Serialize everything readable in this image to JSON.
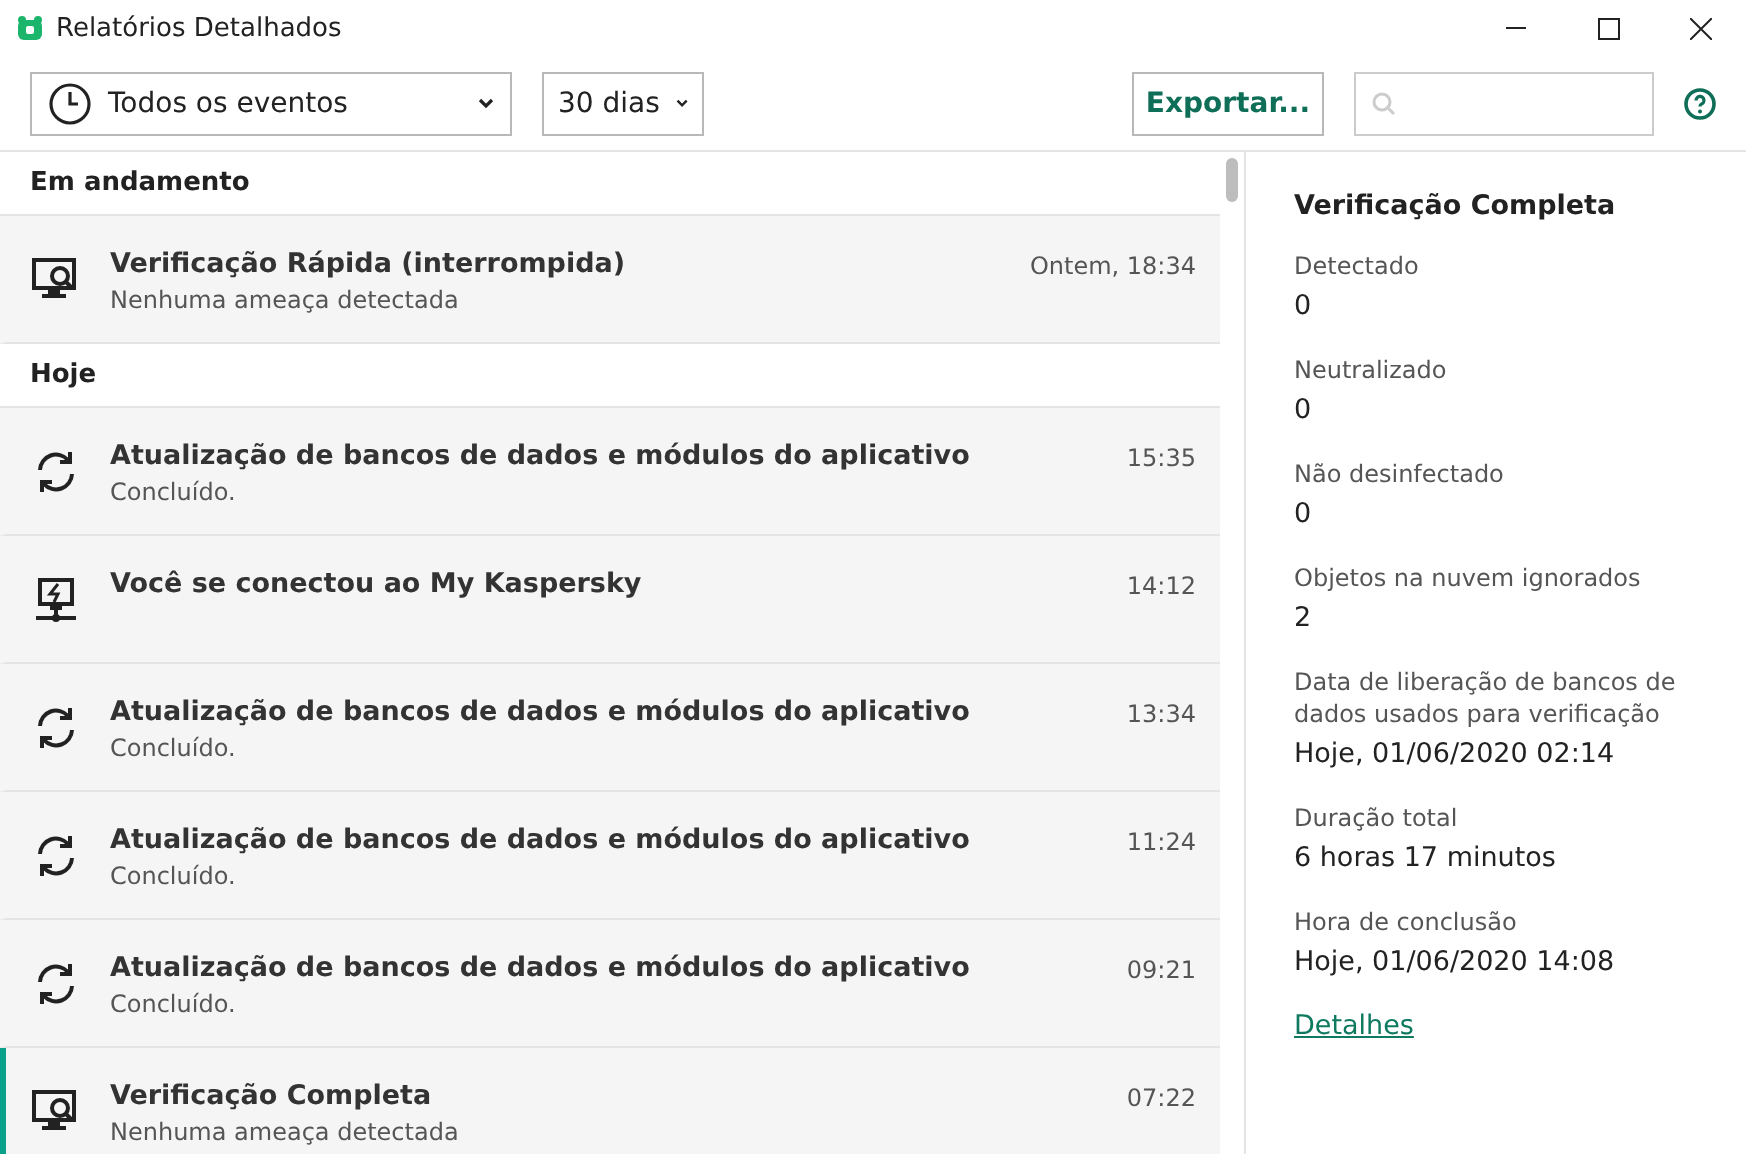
{
  "window": {
    "title": "Relatórios Detalhados"
  },
  "toolbar": {
    "event_filter": "Todos os eventos",
    "period": "30 dias",
    "export_button": "Exportar..."
  },
  "groups": [
    {
      "title": "Em andamento",
      "events": [
        {
          "kind": "scan",
          "title": "Verificação Rápida (interrompida)",
          "subtitle": "Nenhuma ameaça detectada",
          "time": "Ontem, 18:34",
          "selected": false
        }
      ]
    },
    {
      "title": "Hoje",
      "events": [
        {
          "kind": "update",
          "title": "Atualização de bancos de dados e módulos do aplicativo",
          "subtitle": "Concluído.",
          "time": "15:35",
          "selected": false
        },
        {
          "kind": "connect",
          "title": "Você se conectou ao My Kaspersky",
          "time": "14:12",
          "selected": false
        },
        {
          "kind": "update",
          "title": "Atualização de bancos de dados e módulos do aplicativo",
          "subtitle": "Concluído.",
          "time": "13:34",
          "selected": false
        },
        {
          "kind": "update",
          "title": "Atualização de bancos de dados e módulos do aplicativo",
          "subtitle": "Concluído.",
          "time": "11:24",
          "selected": false
        },
        {
          "kind": "update",
          "title": "Atualização de bancos de dados e módulos do aplicativo",
          "subtitle": "Concluído.",
          "time": "09:21",
          "selected": false
        },
        {
          "kind": "scan",
          "title": "Verificação Completa",
          "subtitle": "Nenhuma ameaça detectada",
          "time": "07:22",
          "selected": true
        }
      ]
    }
  ],
  "details": {
    "title": "Verificação Completa",
    "fields": [
      {
        "label": "Detectado",
        "value": "0"
      },
      {
        "label": "Neutralizado",
        "value": "0"
      },
      {
        "label": "Não desinfectado",
        "value": "0"
      },
      {
        "label": "Objetos na nuvem ignorados",
        "value": "2"
      },
      {
        "label": "Data de liberação de bancos de dados usados para verificação",
        "value": "Hoje, 01/06/2020 02:14"
      },
      {
        "label": "Duração total",
        "value": "6 horas 17 minutos"
      },
      {
        "label": "Hora de conclusão",
        "value": "Hoje, 01/06/2020 14:08"
      }
    ],
    "link": "Detalhes"
  }
}
